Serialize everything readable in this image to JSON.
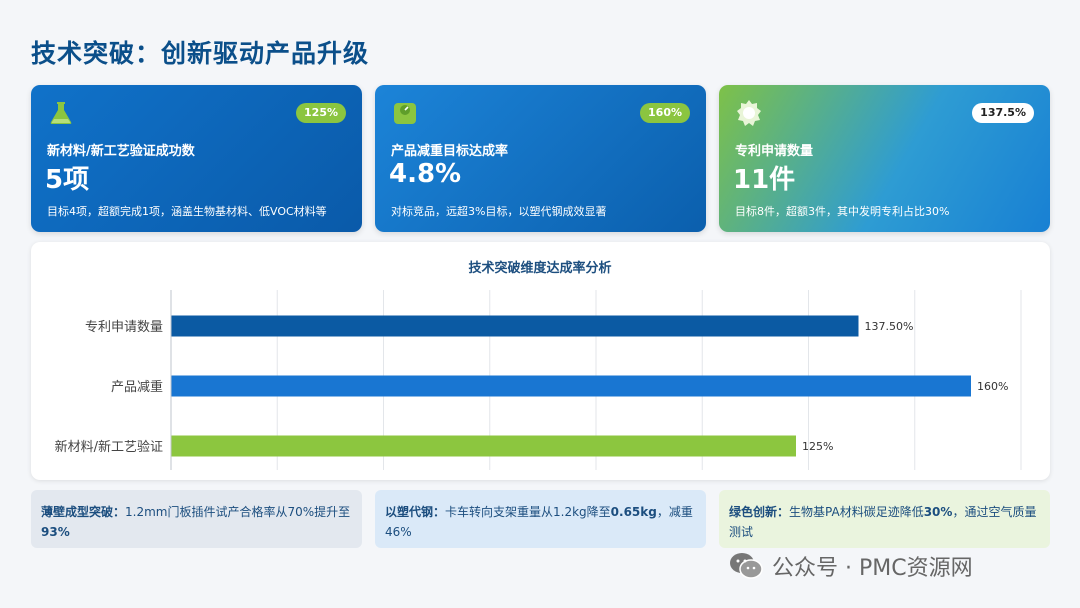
{
  "page": {
    "title": "技术突破：创新驱动产品升级"
  },
  "kpis": [
    {
      "badge": "125%",
      "label": "新材料/新工艺验证成功数",
      "value": "5项",
      "note": "目标4项，超额完成1项，涵盖生物基材料、低VOC材料等",
      "icon": "flask-icon"
    },
    {
      "badge": "160%",
      "label": "产品减重目标达成率",
      "value": "4.8%",
      "note": "对标竞品，远超3%目标，以塑代钢成效显著",
      "icon": "weight-icon"
    },
    {
      "badge": "137.5%",
      "label": "专利申请数量",
      "value": "11件",
      "note": "目标8件，超额3件，其中发明专利占比30%",
      "icon": "badge-icon"
    }
  ],
  "chart_data": {
    "type": "bar",
    "orientation": "horizontal",
    "title": "技术突破维度达成率分析",
    "categories": [
      "专利申请数量",
      "产品减重",
      "新材料/新工艺验证"
    ],
    "values": [
      137.5,
      160,
      125
    ],
    "data_labels": [
      "137.50%",
      "160%",
      "125%"
    ],
    "colors": [
      "#0b5aa3",
      "#1976d2",
      "#8cc63f"
    ],
    "xlim": [
      0,
      170
    ],
    "grid": true,
    "legend": "none"
  },
  "bottom": [
    {
      "title": "薄壁成型突破：",
      "text": "1.2mm门板插件试产合格率从70%提升至",
      "strong_end": "93%"
    },
    {
      "title": "以塑代钢：",
      "text": "卡车转向支架重量从1.2kg降至",
      "strong_mid": "0.65kg",
      "text_end": "，减重46%"
    },
    {
      "title": "绿色创新：",
      "text": "生物基PA材料碳足迹降低",
      "strong_mid": "30%",
      "text_end": "，通过空气质量测试"
    }
  ],
  "watermark": {
    "text": "公众号 · PMC资源网",
    "icon": "wechat-icon"
  }
}
